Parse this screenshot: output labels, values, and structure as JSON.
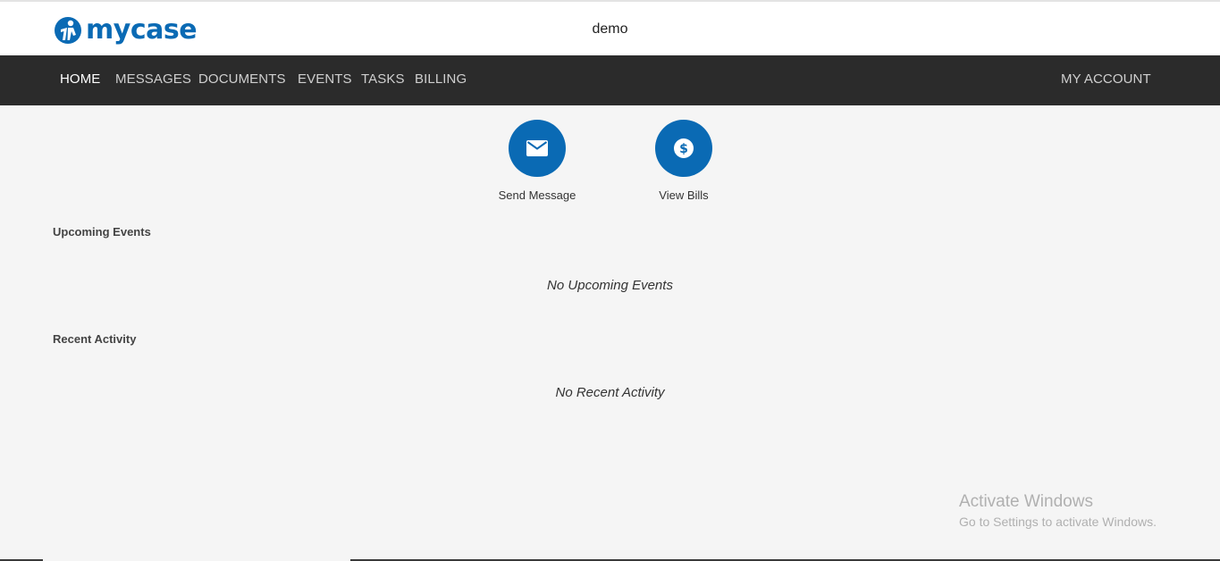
{
  "header": {
    "logo_text": "mycase",
    "firm_name": "demo"
  },
  "nav": {
    "items": [
      {
        "label": "HOME",
        "active": true
      },
      {
        "label": "MESSAGES",
        "active": false
      },
      {
        "label": "DOCUMENTS",
        "active": false
      },
      {
        "label": "EVENTS",
        "active": false
      },
      {
        "label": "TASKS",
        "active": false
      },
      {
        "label": "BILLING",
        "active": false
      }
    ],
    "account_label": "MY ACCOUNT"
  },
  "quick_actions": [
    {
      "label": "Send Message",
      "icon": "envelope-icon"
    },
    {
      "label": "View Bills",
      "icon": "dollar-icon"
    }
  ],
  "upcoming_events": {
    "title": "Upcoming Events",
    "empty_text": "No Upcoming Events"
  },
  "recent_activity": {
    "title": "Recent Activity",
    "empty_text": "No Recent Activity"
  },
  "watermark": {
    "title": "Activate Windows",
    "subtitle": "Go to Settings to activate Windows."
  },
  "colors": {
    "brand_blue": "#0a6ab4",
    "nav_bg": "#2b2b2b",
    "page_bg": "#f5f5f5"
  }
}
